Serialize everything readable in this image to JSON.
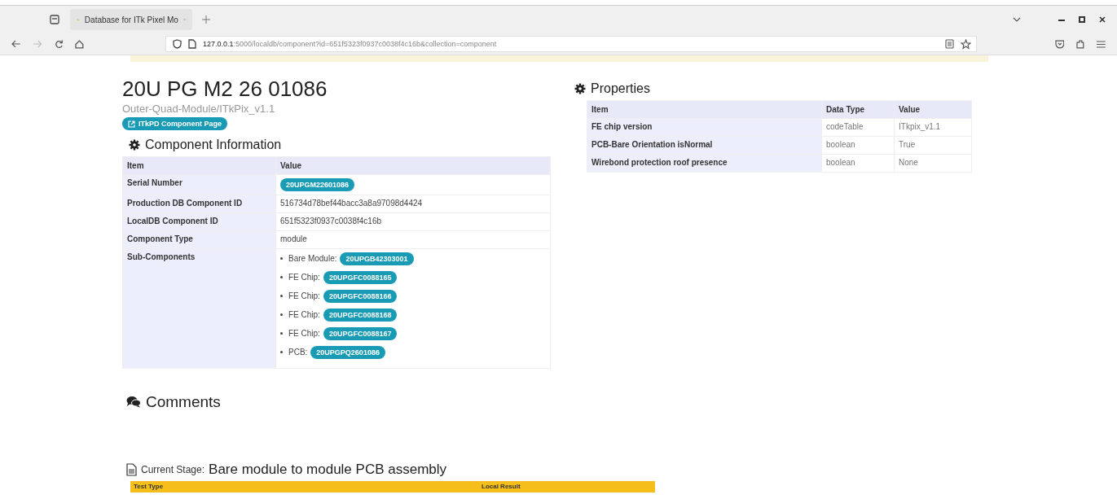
{
  "browser": {
    "tab_title": "Database for ITk Pixel Mo",
    "url": "**127.0.0.1**:5000/localdb/component?id=651f5323f0937c0038f4c16b&collection=component"
  },
  "component": {
    "title": "20U PG M2 26 01086",
    "subtitle": "Outer-Quad-Module/ITkPix_v1.1",
    "link": "ITkPD Component Page"
  },
  "info": {
    "heading": "Component Information",
    "columns": [
      "Item",
      "Value"
    ],
    "rows": [
      {
        "kind": "badge",
        "item": "Serial Number",
        "value": "20UPGM22601086"
      },
      {
        "kind": "text",
        "item": "Production DB Component ID",
        "value": "516734d78bef44bacc3a8a97098d4424"
      },
      {
        "kind": "text",
        "item": "LocalDB Component ID",
        "value": "651f5323f0937c0038f4c16b"
      },
      {
        "kind": "text",
        "item": "Component Type",
        "value": "module"
      },
      {
        "kind": "list",
        "item": "Sub-Components",
        "children": [
          {
            "label": "Bare Module:",
            "serial": "20UPGB42303001"
          },
          {
            "label": "FE Chip:",
            "serial": "20UPGFC0088165"
          },
          {
            "label": "FE Chip:",
            "serial": "20UPGFC0088166"
          },
          {
            "label": "FE Chip:",
            "serial": "20UPGFC0088168"
          },
          {
            "label": "FE Chip:",
            "serial": "20UPGFC0088167"
          },
          {
            "label": "PCB:",
            "serial": "20UPGPQ2601086"
          }
        ]
      }
    ]
  },
  "properties": {
    "heading": "Properties",
    "columns": [
      "Item",
      "Data Type",
      "Value"
    ],
    "rows": [
      {
        "item": "FE chip version",
        "type": "codeTable",
        "value": "ITkpix_v1.1"
      },
      {
        "item": "PCB-Bare Orientation isNormal",
        "type": "boolean",
        "value": "True"
      },
      {
        "item": "Wirebond protection roof presence",
        "type": "boolean",
        "value": "None"
      }
    ]
  },
  "comments": {
    "heading": "Comments"
  },
  "stage": {
    "label": "Current Stage:",
    "name": "Bare module to module PCB assembly",
    "columns": [
      "Test Type",
      "Local Result"
    ]
  }
}
